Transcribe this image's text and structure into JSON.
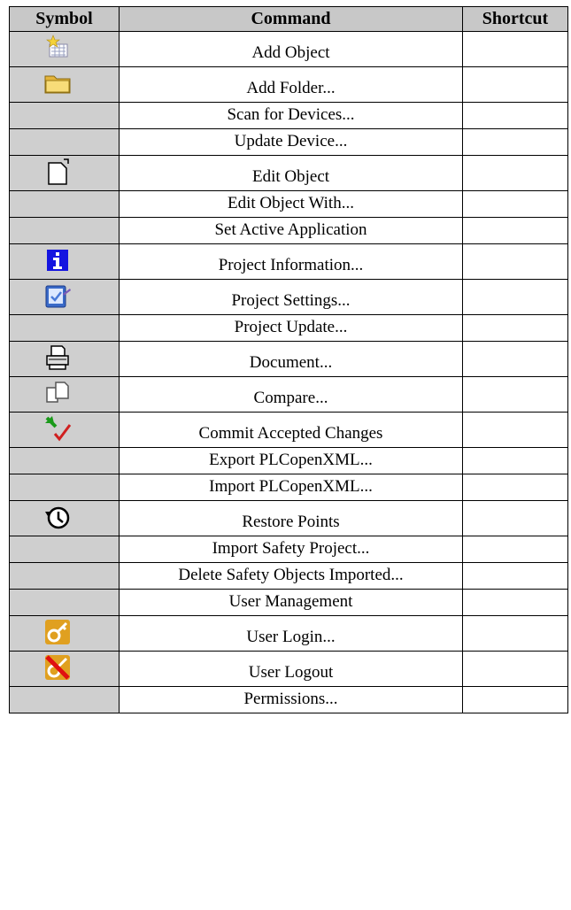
{
  "headers": [
    "Symbol",
    "Command",
    "Shortcut"
  ],
  "rows": [
    {
      "command": "Add Object",
      "icon": "add-object-icon",
      "shortcut": ""
    },
    {
      "command": "Add Folder...",
      "icon": "folder-icon",
      "shortcut": ""
    },
    {
      "command": "Scan for Devices...",
      "icon": "",
      "shortcut": ""
    },
    {
      "command": "Update Device...",
      "icon": "",
      "shortcut": ""
    },
    {
      "command": "Edit Object",
      "icon": "edit-object-icon",
      "shortcut": ""
    },
    {
      "command": "Edit Object With...",
      "icon": "",
      "shortcut": ""
    },
    {
      "command": "Set Active Application",
      "icon": "",
      "shortcut": ""
    },
    {
      "command": "Project Information...",
      "icon": "info-icon",
      "shortcut": ""
    },
    {
      "command": "Project Settings...",
      "icon": "project-settings-icon",
      "shortcut": ""
    },
    {
      "command": "Project Update...",
      "icon": "",
      "shortcut": ""
    },
    {
      "command": "Document...",
      "icon": "printer-icon",
      "shortcut": ""
    },
    {
      "command": "Compare...",
      "icon": "compare-icon",
      "shortcut": ""
    },
    {
      "command": "Commit Accepted Changes",
      "icon": "commit-changes-icon",
      "shortcut": ""
    },
    {
      "command": "Export PLCopenXML...",
      "icon": "",
      "shortcut": ""
    },
    {
      "command": "Import PLCopenXML...",
      "icon": "",
      "shortcut": ""
    },
    {
      "command": "Restore Points",
      "icon": "history-icon",
      "shortcut": ""
    },
    {
      "command": "Import Safety Project...",
      "icon": "",
      "shortcut": ""
    },
    {
      "command": "Delete Safety Objects Imported...",
      "icon": "",
      "shortcut": ""
    },
    {
      "command": "User Management",
      "icon": "",
      "shortcut": ""
    },
    {
      "command": "User Login...",
      "icon": "key-icon",
      "shortcut": ""
    },
    {
      "command": "User Logout",
      "icon": "key-no-icon",
      "shortcut": ""
    },
    {
      "command": "Permissions...",
      "icon": "",
      "shortcut": ""
    }
  ]
}
